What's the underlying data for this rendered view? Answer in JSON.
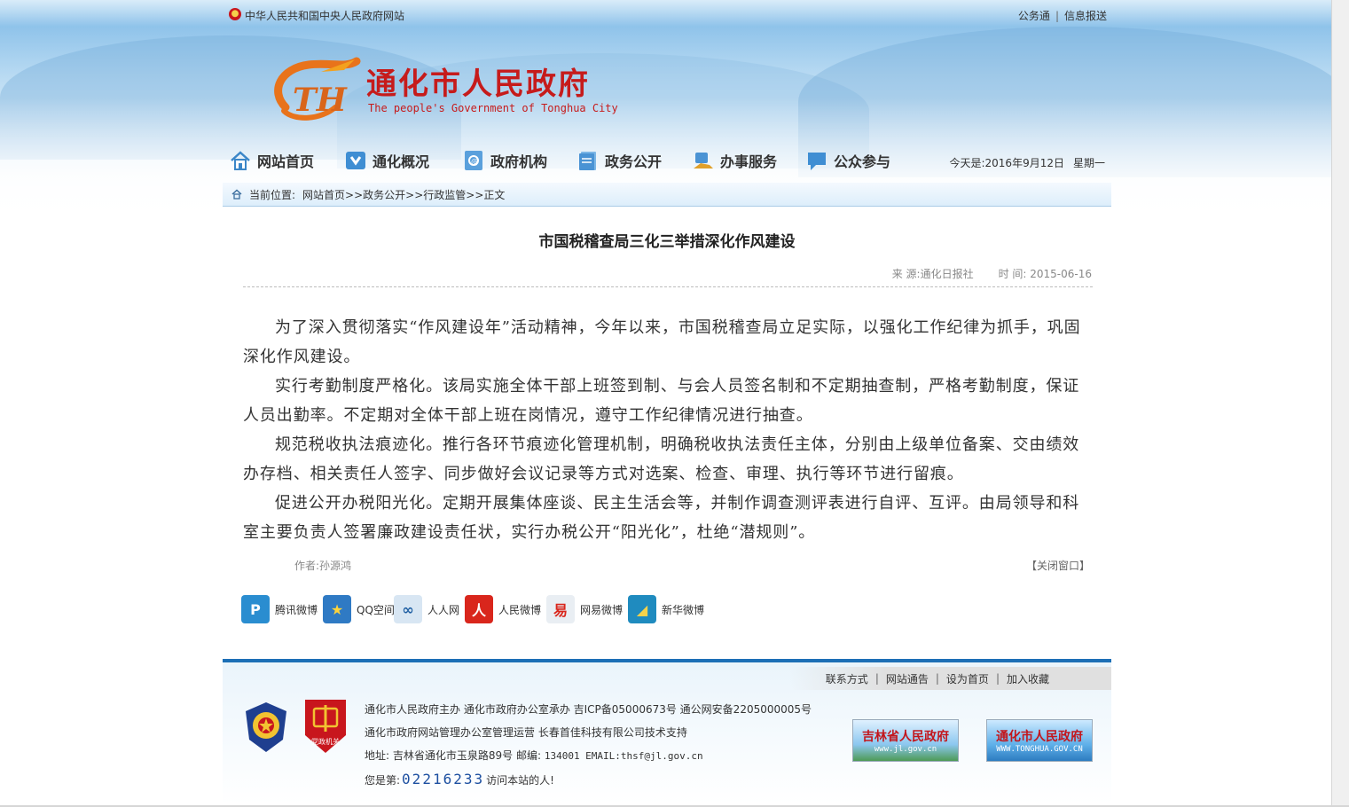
{
  "top": {
    "gov_link": "中华人民共和国中央人民政府网站",
    "right_links": [
      "公务通",
      "信息报送"
    ]
  },
  "logo": {
    "cn": "通化市人民政府",
    "en": "The people's Government of Tonghua City",
    "mark_letters": "TH"
  },
  "nav": {
    "items": [
      {
        "label": "网站首页",
        "icon": "home-icon"
      },
      {
        "label": "通化概况",
        "icon": "overview-icon"
      },
      {
        "label": "政府机构",
        "icon": "institution-icon"
      },
      {
        "label": "政务公开",
        "icon": "document-icon"
      },
      {
        "label": "办事服务",
        "icon": "service-icon"
      },
      {
        "label": "公众参与",
        "icon": "speech-bubble-icon"
      }
    ],
    "date": "今天是:2016年9月12日",
    "weekday": "星期一"
  },
  "breadcrumb": {
    "label": "当前位置:",
    "path": "网站首页>>政务公开>>行政监管>>正文"
  },
  "article": {
    "title": "市国税稽查局三化三举措深化作风建设",
    "source": "来 源:通化日报社",
    "time": "时 间: 2015-06-16",
    "paragraphs": [
      "为了深入贯彻落实“作风建设年”活动精神，今年以来，市国税稽查局立足实际，以强化工作纪律为抓手，巩固深化作风建设。",
      "实行考勤制度严格化。该局实施全体干部上班签到制、与会人员签名制和不定期抽查制，严格考勤制度，保证人员出勤率。不定期对全体干部上班在岗情况，遵守工作纪律情况进行抽查。",
      "规范税收执法痕迹化。推行各环节痕迹化管理机制，明确税收执法责任主体，分别由上级单位备案、交由绩效办存档、相关责任人签字、同步做好会议记录等方式对选案、检查、审理、执行等环节进行留痕。",
      "促进公开办税阳光化。定期开展集体座谈、民主生活会等，并制作调查测评表进行自评、互评。由局领导和科室主要负责人签署廉政建设责任状，实行办税公开“阳光化”，杜绝“潜规则”。"
    ],
    "author": "作者:孙源鸿",
    "close": "【关闭窗口】"
  },
  "share": [
    {
      "label": "腾讯微博",
      "icon": "tencent-weibo-icon",
      "color": "#2a8dd0",
      "glyph": "P"
    },
    {
      "label": "QQ空间",
      "icon": "qzone-icon",
      "color": "#2f7ac4",
      "glyph": "★"
    },
    {
      "label": "人人网",
      "icon": "renren-icon",
      "color": "#d8e6f3",
      "glyph": "∞"
    },
    {
      "label": "人民微博",
      "icon": "people-weibo-icon",
      "color": "#d9261c",
      "glyph": "人"
    },
    {
      "label": "网易微博",
      "icon": "netease-weibo-icon",
      "color": "#e9eef3",
      "glyph": "易"
    },
    {
      "label": "新华微博",
      "icon": "xinhua-weibo-icon",
      "color": "#1f8bbf",
      "glyph": "◢"
    }
  ],
  "footer": {
    "links": [
      "联系方式",
      "网站通告",
      "设为首页",
      "加入收藏"
    ],
    "line1": "通化市人民政府主办  通化市政府办公室承办  吉ICP备05000673号  通公网安备2205000005号",
    "line2": "通化市政府网站管理办公室管理运营  长春首佳科技有限公司技术支持",
    "line3_prefix": "地址: 吉林省通化市玉泉路89号 邮编:",
    "line3_mono": "134001 EMAIL:thsf@jl.gov.cn",
    "visit_prefix": "您是第:",
    "visit_count": "02216233",
    "visit_suffix": "访问本站的人!",
    "party_badge_text": "党政机关",
    "banner1_title": "吉林省人民政府",
    "banner1_url": "www.jl.gov.cn",
    "banner2_title": "通化市人民政府",
    "banner2_url": "WWW.TONGHUA.GOV.CN"
  }
}
